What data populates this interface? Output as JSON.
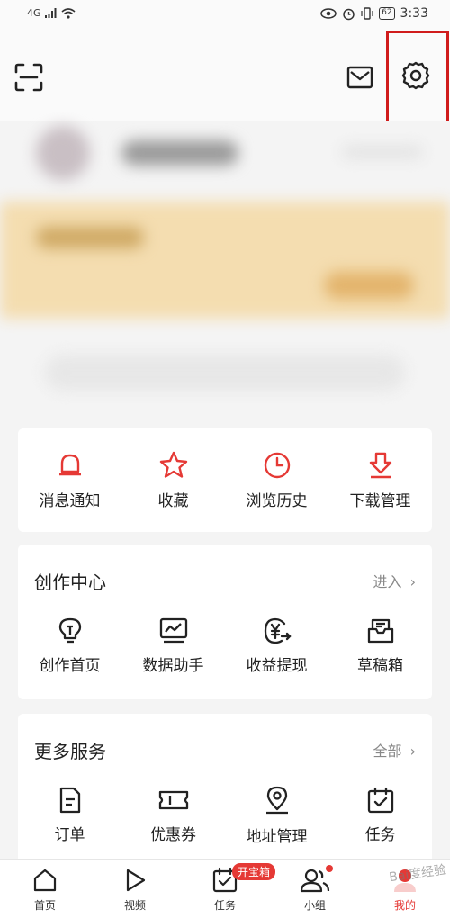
{
  "status_bar": {
    "signal": "4G",
    "battery": "62",
    "time": "3:33"
  },
  "quick_actions": [
    {
      "label": "消息通知",
      "icon": "bell-icon"
    },
    {
      "label": "收藏",
      "icon": "star-icon"
    },
    {
      "label": "浏览历史",
      "icon": "clock-icon"
    },
    {
      "label": "下载管理",
      "icon": "download-icon"
    }
  ],
  "creation_center": {
    "title": "创作中心",
    "link": "进入",
    "items": [
      {
        "label": "创作首页",
        "icon": "lightbulb-icon"
      },
      {
        "label": "数据助手",
        "icon": "chart-monitor-icon"
      },
      {
        "label": "收益提现",
        "icon": "yuan-withdraw-icon"
      },
      {
        "label": "草稿箱",
        "icon": "draft-box-icon"
      }
    ]
  },
  "more_services": {
    "title": "更多服务",
    "link": "全部",
    "items": [
      {
        "label": "订单",
        "icon": "order-icon"
      },
      {
        "label": "优惠券",
        "icon": "coupon-icon"
      },
      {
        "label": "地址管理",
        "icon": "location-icon"
      },
      {
        "label": "任务",
        "icon": "task-icon"
      }
    ]
  },
  "bottom_nav": [
    {
      "label": "首页",
      "icon": "home-icon"
    },
    {
      "label": "视频",
      "icon": "video-play-icon"
    },
    {
      "label": "任务",
      "icon": "task-calendar-icon",
      "badge": "开宝箱"
    },
    {
      "label": "小组",
      "icon": "group-icon"
    },
    {
      "label": "我的",
      "icon": "profile-icon"
    }
  ],
  "watermark": "Bai度经验",
  "colors": {
    "accent": "#e53935",
    "highlight": "#d01c1c",
    "background": "#f4f4f4"
  }
}
